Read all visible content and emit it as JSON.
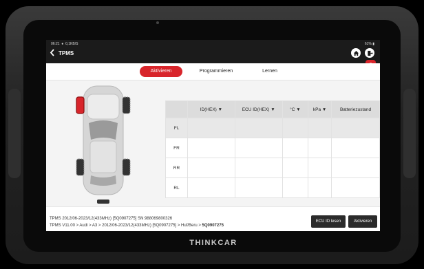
{
  "status": {
    "time": "06:21",
    "net": "0,1KB/S",
    "battery": "61%"
  },
  "header": {
    "title": "TPMS"
  },
  "tabs": [
    {
      "label": "Aktivieren"
    },
    {
      "label": "Programmieren"
    },
    {
      "label": "Lernen"
    }
  ],
  "table": {
    "columns": [
      "",
      "ID(HEX) ▼",
      "ECU ID(HEX) ▼",
      "°C ▼",
      "kPa ▼",
      "Batteriezustand"
    ],
    "rows": [
      {
        "label": "FL"
      },
      {
        "label": "FR"
      },
      {
        "label": "RR"
      },
      {
        "label": "RL"
      }
    ]
  },
  "footer": {
    "line1": "TPMS  2012/06-2023/12(433MHz) [5Q0907275] SN:988069800326",
    "line2_prefix": "TPMS V11.00 > Audi > A3 > 2012/06-2023/12(433MHz) [5Q0907275] > Huf/Beru > ",
    "line2_bold": "5Q0907275",
    "ecu_button": "ECU ID lesen",
    "activate_button": "Aktivieren"
  },
  "brand": "THINKCAR",
  "colors": {
    "accent": "#d8252b",
    "header_bg": "#1b1b1b",
    "button_bg": "#2b2b2b"
  }
}
